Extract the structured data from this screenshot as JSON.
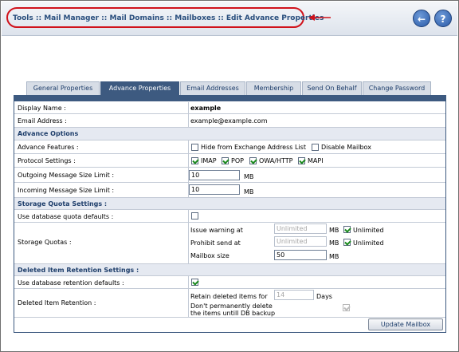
{
  "breadcrumb": "Tools :: Mail Manager :: Mail Domains :: Mailboxes :: Edit Advance Properties",
  "header": {
    "back_icon": "back-arrow-icon",
    "help_icon": "help-icon",
    "back_glyph": "←",
    "help_glyph": "?"
  },
  "tabs": [
    "General Properties",
    "Advance Properties",
    "Email Addresses",
    "Membership",
    "Send On Behalf",
    "Change Password"
  ],
  "active_tab": "Advance Properties",
  "fields": {
    "display_name_label": "Display Name :",
    "display_name_value": "example",
    "email_label": "Email Address :",
    "email_value": "example@example.com"
  },
  "advance": {
    "section": "Advance Options",
    "features_label": "Advance Features :",
    "hide_gal": "Hide from Exchange Address List",
    "disable_mailbox": "Disable Mailbox",
    "protocol_label": "Protocol Settings :",
    "imap": "IMAP",
    "pop": "POP",
    "owa": "OWA/HTTP",
    "mapi": "MAPI",
    "out_label": "Outgoing Message Size Limit :",
    "out_value": "10",
    "out_unit": "MB",
    "in_label": "Incoming Message Size Limit :",
    "in_value": "10",
    "in_unit": "MB"
  },
  "quota": {
    "section": "Storage Quota Settings :",
    "defaults_label": "Use database quota defaults :",
    "quotas_label": "Storage Quotas :",
    "issue_label": "Issue warning at",
    "issue_value": "Unlimited",
    "issue_unit": "MB",
    "issue_unlimited": "Unlimited",
    "prohibit_label": "Prohibit send at",
    "prohibit_value": "Unlimited",
    "prohibit_unit": "MB",
    "prohibit_unlimited": "Unlimited",
    "mailbox_label": "Mailbox size",
    "mailbox_value": "50",
    "mailbox_unit": "MB"
  },
  "retention": {
    "section": "Deleted Item Retention Settings :",
    "defaults_label": "Use database retention defaults :",
    "label": "Deleted Item Retention :",
    "retain_label": "Retain deleted items for",
    "retain_value": "14",
    "retain_unit": "Days",
    "dont_delete_1": "Don't permanently delete",
    "dont_delete_2": "the items untill DB backup"
  },
  "button": "Update Mailbox",
  "colors": {
    "accent": "#3d5a80",
    "breadcrumb": "#2a4f7e",
    "highlight": "#d0121b"
  }
}
